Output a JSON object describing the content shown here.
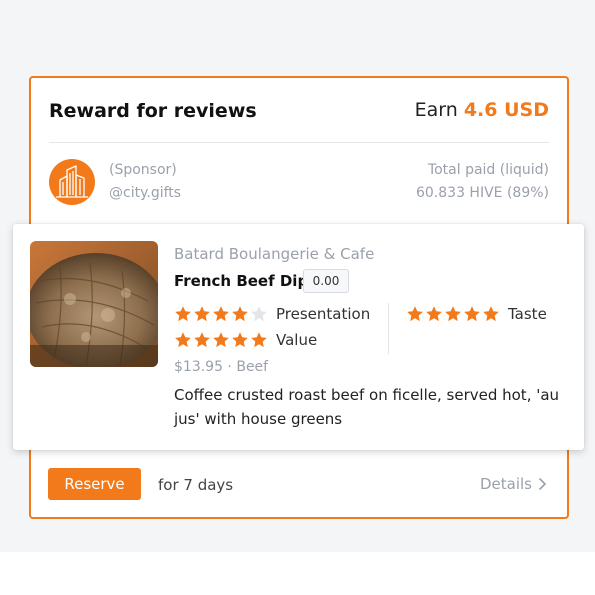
{
  "reward": {
    "title": "Reward for reviews",
    "earn_label": "Earn",
    "earn_amount": "4.6 USD",
    "accent_color": "#f27a1a"
  },
  "sponsor": {
    "logo_icon": "city-buildings-icon",
    "role": "(Sponsor)",
    "name": "@city.gifts",
    "paid_label": "Total paid (liquid)",
    "paid_value": "60.833 HIVE (89%)"
  },
  "item": {
    "restaurant": "Batard Boulangerie & Cafe",
    "dish": "French Beef Dip",
    "score": "0.00",
    "ratings": [
      {
        "label": "Presentation",
        "stars": 4,
        "max": 5
      },
      {
        "label": "Taste",
        "stars": 5,
        "max": 5
      },
      {
        "label": "Value",
        "stars": 5,
        "max": 5
      }
    ],
    "price_category": "$13.95 · Beef",
    "description": "Coffee crusted roast beef on ficelle, served hot, 'au jus' with house greens"
  },
  "actions": {
    "reserve_label": "Reserve",
    "reserve_duration": "for 7 days",
    "details_label": "Details"
  }
}
